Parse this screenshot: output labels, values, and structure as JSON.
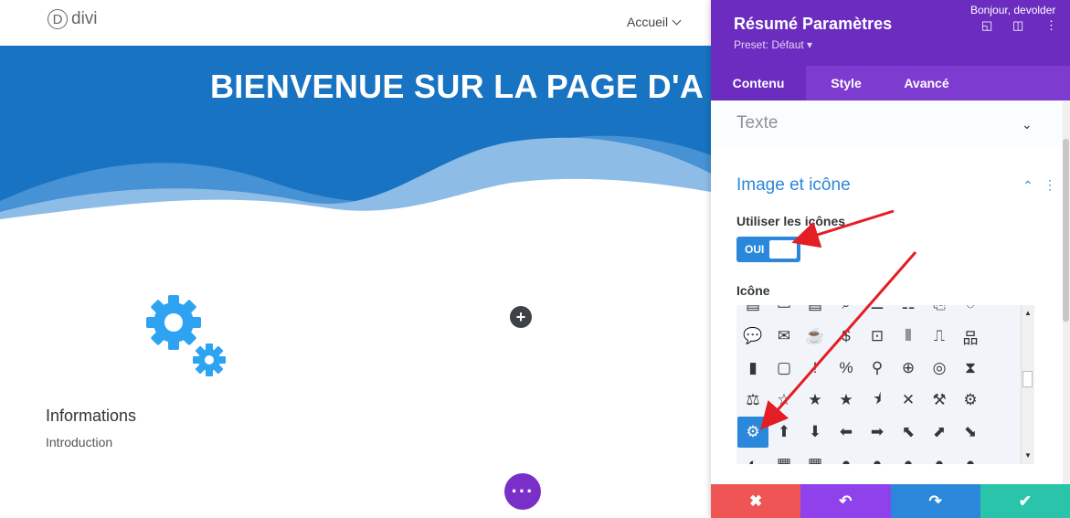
{
  "site": {
    "logo_letter": "D",
    "logo_text": "divi",
    "nav_item": "Accueil",
    "hero_title": "BIENVENUE SUR LA PAGE D'A",
    "add_button": "+",
    "info_title": "Informations",
    "info_subtitle": "Introduction",
    "more_button": "···"
  },
  "panel": {
    "title": "Résumé Paramètres",
    "preset": "Preset: Défaut ▾",
    "greeting": "Bonjour, devolder",
    "tabs": [
      {
        "label": "Contenu",
        "active": true
      },
      {
        "label": "Style",
        "active": false
      },
      {
        "label": "Avancé",
        "active": false
      }
    ],
    "section_text": "Texte",
    "section_image": "Image et icône",
    "use_icons_label": "Utiliser les icônes",
    "toggle_value": "OUI",
    "icon_label": "Icône",
    "footer": {
      "cancel": "✖",
      "undo": "↶",
      "redo": "↷",
      "save": "✔"
    }
  },
  "icon_rows": [
    [
      "▤",
      "▭",
      "▤",
      "⌕",
      "☰",
      "☷",
      "⎘",
      "◌"
    ],
    [
      "💬",
      "✉",
      "☕",
      "$",
      "⊡",
      "⫴",
      "⎍",
      "品"
    ],
    [
      "▮",
      "▢",
      "!",
      "%",
      "⚲",
      "⊕",
      "◎",
      "⧗"
    ],
    [
      "⚖",
      "☆",
      "★",
      "★",
      "⯨",
      "✕",
      "⚒",
      "⚙"
    ],
    [
      "⚙",
      "⬆",
      "⬇",
      "⬅",
      "➡",
      "⬉",
      "⬈",
      "⬊"
    ],
    [
      "◐",
      "▦",
      "▦",
      "●",
      "●",
      "●",
      "●",
      "●"
    ]
  ],
  "colors": {
    "brand_purple": "#6b2cbf",
    "tab_purple": "#7e3bd0",
    "hero_blue": "#1873c2",
    "toggle_blue": "#2b87da",
    "cancel_red": "#ef5555",
    "undo_purple": "#8f42ec",
    "redo_blue": "#2b87da",
    "save_green": "#29c4a9",
    "annotation_arrow": "#e31e24"
  }
}
